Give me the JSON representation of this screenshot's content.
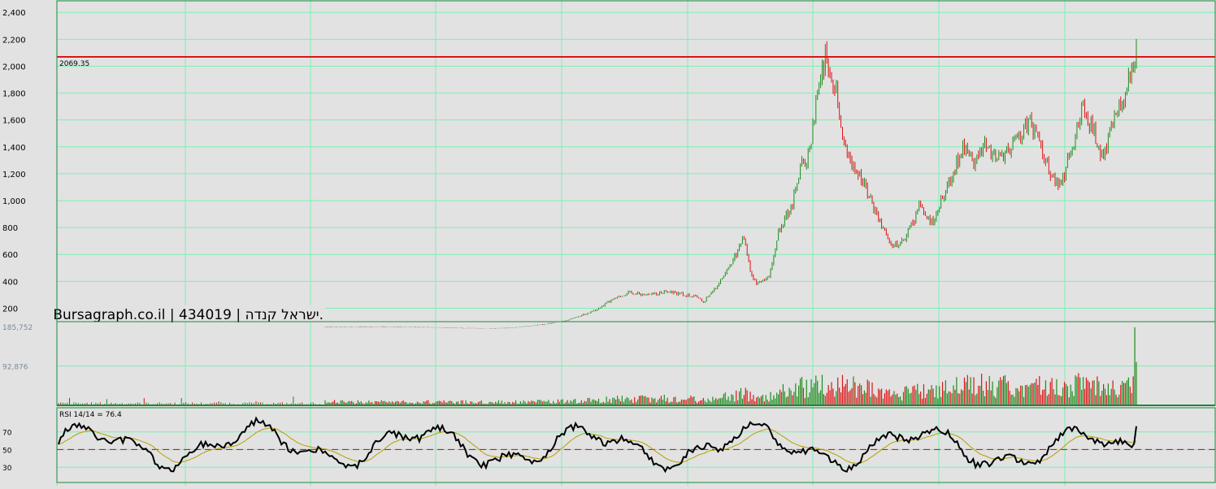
{
  "watermark": "Bursagraph.co.il | 434019 | ישראל קנדה.",
  "colors": {
    "background": "#e2e2e2",
    "grid": "#7cf0b4",
    "frame": "#188a3c",
    "up": "#1c8c1c",
    "down": "#dc1414",
    "resistance": "#dc1414",
    "rsi_line": "#000000",
    "rsi_signal": "#b4a000",
    "rsi_midline": "#dc1414"
  },
  "chart_data": [
    {
      "type": "candlestick",
      "panel": "price",
      "y_ticks": [
        "2,400",
        "2,200",
        "2,000",
        "1,800",
        "1,600",
        "1,400",
        "1,200",
        "1,000",
        "800",
        "600",
        "400",
        "200"
      ],
      "ylim": [
        100,
        2480
      ],
      "grid": true,
      "resistance_line": {
        "value": 2069.35,
        "label": "2069.35"
      },
      "series_points": [
        [
          0.0,
          60
        ],
        [
          0.1,
          62
        ],
        [
          0.2,
          58
        ],
        [
          0.3,
          48
        ],
        [
          0.35,
          55
        ],
        [
          0.4,
          78
        ],
        [
          0.45,
          112
        ],
        [
          0.48,
          155
        ],
        [
          0.5,
          185
        ],
        [
          0.53,
          260
        ],
        [
          0.56,
          318
        ],
        [
          0.6,
          298
        ],
        [
          0.63,
          325
        ],
        [
          0.66,
          302
        ],
        [
          0.69,
          280
        ],
        [
          0.7,
          240
        ],
        [
          0.71,
          300
        ],
        [
          0.72,
          340
        ],
        [
          0.74,
          460
        ],
        [
          0.76,
          600
        ],
        [
          0.775,
          740
        ],
        [
          0.78,
          620
        ],
        [
          0.785,
          480
        ],
        [
          0.79,
          420
        ],
        [
          0.8,
          380
        ],
        [
          0.82,
          420
        ],
        [
          0.835,
          720
        ],
        [
          0.85,
          880
        ],
        [
          0.86,
          900
        ],
        [
          0.87,
          1120
        ],
        [
          0.88,
          1260
        ],
        [
          0.89,
          1300
        ],
        [
          0.9,
          1500
        ],
        [
          0.91,
          1800
        ],
        [
          0.925,
          2060
        ],
        [
          0.93,
          1950
        ],
        [
          0.945,
          1820
        ],
        [
          0.96,
          1450
        ],
        [
          0.97,
          1280
        ],
        [
          0.98,
          1250
        ],
        [
          1.0,
          1100
        ],
        [
          1.02,
          880
        ],
        [
          1.04,
          720
        ],
        [
          1.06,
          650
        ],
        [
          1.08,
          780
        ],
        [
          1.1,
          950
        ],
        [
          1.12,
          820
        ],
        [
          1.14,
          1000
        ],
        [
          1.16,
          1200
        ],
        [
          1.18,
          1420
        ],
        [
          1.2,
          1300
        ],
        [
          1.22,
          1400
        ],
        [
          1.24,
          1300
        ],
        [
          1.26,
          1380
        ],
        [
          1.28,
          1450
        ],
        [
          1.3,
          1600
        ],
        [
          1.32,
          1450
        ],
        [
          1.34,
          1200
        ],
        [
          1.36,
          1100
        ],
        [
          1.38,
          1400
        ],
        [
          1.4,
          1680
        ],
        [
          1.42,
          1530
        ],
        [
          1.44,
          1320
        ],
        [
          1.46,
          1620
        ],
        [
          1.48,
          1780
        ],
        [
          1.5,
          2160
        ]
      ]
    },
    {
      "type": "bar",
      "panel": "volume",
      "y_ticks": [
        "185,752",
        "92,876"
      ],
      "ylim": [
        0,
        185752
      ]
    },
    {
      "type": "line",
      "panel": "rsi",
      "label": "RSI 14/14 = 76.4",
      "y_ticks": [
        "70",
        "50",
        "30"
      ],
      "ylim": [
        0,
        100
      ],
      "midline": 50
    }
  ]
}
